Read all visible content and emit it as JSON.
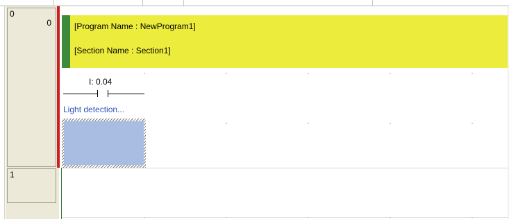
{
  "ladder": {
    "rungs": [
      {
        "number": "0",
        "step": "0"
      },
      {
        "number": "1",
        "step": ""
      }
    ],
    "comment": {
      "program_name_line": "[Program Name : NewProgram1]",
      "section_name_line": "[Section Name : Section1]"
    },
    "contact": {
      "address": "I: 0.04",
      "comment": "Light detection..."
    }
  },
  "colors": {
    "gutter": "#ece9d8",
    "rail_active": "#cc2020",
    "comment_fill": "#ecec3c",
    "comment_bar": "#3d8a3d",
    "cursor_fill": "#a9bde3",
    "contact_comment_text": "#2f56b8"
  }
}
